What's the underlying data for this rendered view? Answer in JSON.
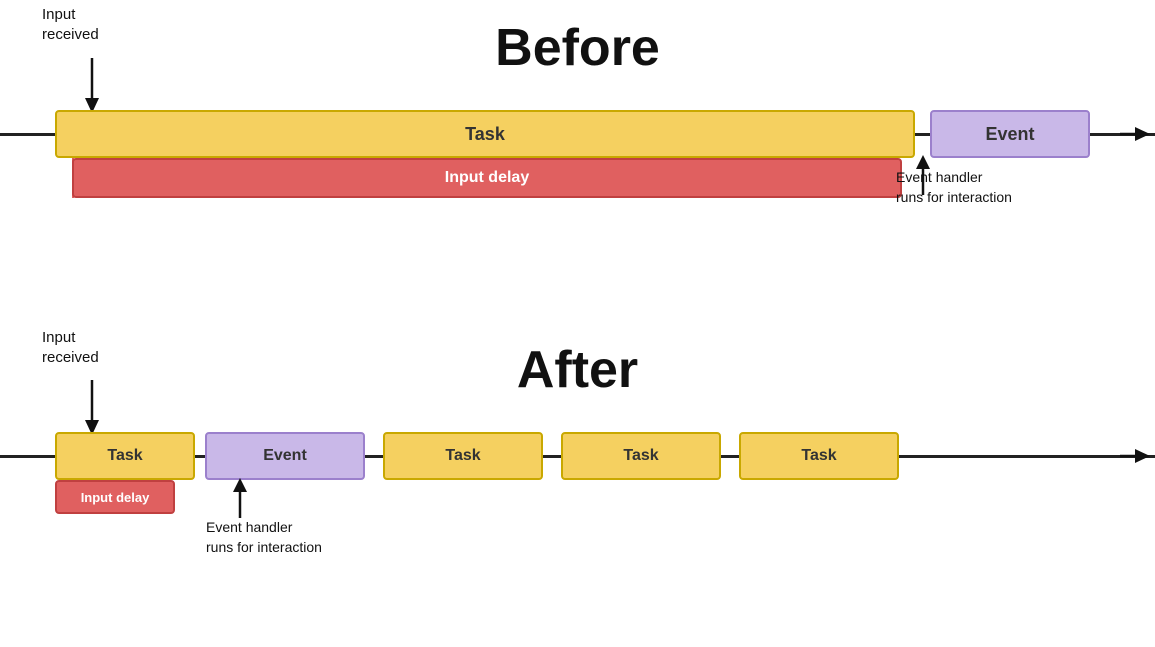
{
  "before": {
    "title": "Before",
    "input_received_label": "Input\nreceived",
    "task_label": "Task",
    "input_delay_label": "Input delay",
    "event_label": "Event",
    "event_handler_label": "Event handler\nruns for interaction"
  },
  "after": {
    "title": "After",
    "input_received_label": "Input\nreceived",
    "task_label_1": "Task",
    "event_label": "Event",
    "task_label_2": "Task",
    "task_label_3": "Task",
    "task_label_4": "Task",
    "input_delay_label": "Input delay",
    "event_handler_label": "Event handler\nruns for interaction"
  }
}
